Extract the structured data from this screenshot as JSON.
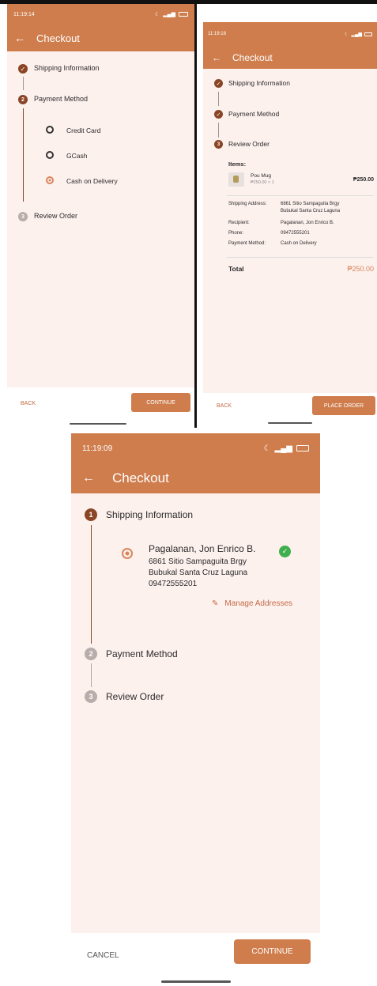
{
  "screen_a": {
    "time": "11:19:14",
    "title": "Checkout",
    "steps": {
      "shipping": "Shipping Information",
      "payment": "Payment Method",
      "review": "Review Order"
    },
    "step_numbers": {
      "payment": "2",
      "review": "3"
    },
    "payment_options": [
      "Credit Card",
      "GCash",
      "Cash on Delivery"
    ],
    "selected_option": "Cash on Delivery",
    "back": "BACK",
    "continue": "CONTINUE"
  },
  "screen_b": {
    "time": "11:19:18",
    "title": "Checkout",
    "steps": {
      "shipping": "Shipping Information",
      "payment": "Payment Method",
      "review": "Review Order"
    },
    "step_numbers": {
      "review": "3"
    },
    "items_label": "Items:",
    "item": {
      "name": "Pou Mug",
      "detail": "₱250.00 × 1",
      "price": "₱250.00"
    },
    "details": {
      "address_label": "Shipping Address:",
      "address_1": "6861 Sitio Sampaguita Brgy",
      "address_2": "Bubukal Santa Cruz Laguna",
      "recipient_label": "Recipient:",
      "recipient": "Pagalanan, Jon Enrico B.",
      "phone_label": "Phone:",
      "phone": "09472555201",
      "payment_label": "Payment Method:",
      "payment": "Cash on Delivery"
    },
    "total_label": "Total",
    "total": "₱250.00",
    "back": "BACK",
    "place_order": "PLACE ORDER"
  },
  "screen_c": {
    "time": "11:19:09",
    "title": "Checkout",
    "steps": {
      "shipping": "Shipping Information",
      "payment": "Payment Method",
      "review": "Review Order"
    },
    "step_numbers": {
      "shipping": "1",
      "payment": "2",
      "review": "3"
    },
    "address": {
      "name": "Pagalanan, Jon Enrico B.",
      "line1": "6861 Sitio Sampaguita Brgy",
      "line2": "Bubukal Santa Cruz Laguna",
      "phone": "09472555201"
    },
    "manage": "Manage Addresses",
    "cancel": "CANCEL",
    "continue": "CONTINUE"
  },
  "colors": {
    "brand": "#cf7d4c",
    "step_dark": "#8a4526",
    "surface": "#fdf1ee",
    "success": "#3fae4d"
  }
}
